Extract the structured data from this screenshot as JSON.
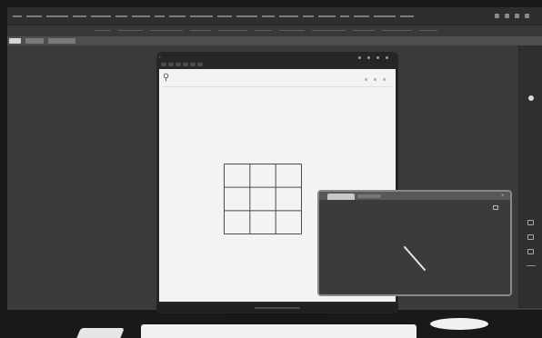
{
  "menubar": {
    "menu_items": [
      {
        "label": ""
      },
      {
        "label": ""
      },
      {
        "label": ""
      },
      {
        "label": ""
      },
      {
        "label": ""
      },
      {
        "label": ""
      },
      {
        "label": ""
      },
      {
        "label": ""
      },
      {
        "label": ""
      },
      {
        "label": ""
      },
      {
        "label": ""
      },
      {
        "label": ""
      },
      {
        "label": ""
      },
      {
        "label": ""
      },
      {
        "label": ""
      },
      {
        "label": ""
      },
      {
        "label": ""
      },
      {
        "label": ""
      },
      {
        "label": ""
      },
      {
        "label": ""
      }
    ],
    "status_icons": [
      "wifi-icon",
      "battery-icon",
      "clock-icon",
      "notification-icon"
    ]
  },
  "ribbon": {
    "items": [
      "",
      "",
      "",
      "",
      "",
      "",
      "",
      "",
      "",
      "",
      ""
    ]
  },
  "tabrow": {
    "tabs": [
      {
        "label": "",
        "active": true
      },
      {
        "label": "",
        "active": false
      },
      {
        "label": "",
        "active": false
      }
    ]
  },
  "app_window": {
    "title": "",
    "back_icon": "chevron-left-icon",
    "controls": [
      "share-icon",
      "more-icon",
      "minimize-icon",
      "close-icon"
    ],
    "toolbar_tabs": [
      "",
      "",
      "",
      "",
      "",
      ""
    ],
    "search": {
      "icon": "search-icon",
      "placeholder": ""
    },
    "canvas_controls": [
      "undo-icon",
      "redo-icon",
      "settings-icon"
    ],
    "grid": {
      "rows": 3,
      "cols": 3
    }
  },
  "mini_window": {
    "active_tab": "",
    "inactive_tab": "",
    "close_icon": "close-icon",
    "tool_icon": "chat-icon"
  },
  "right_panel": {
    "tools": [
      "layers-icon",
      "image-icon",
      "text-icon",
      "minus-icon"
    ]
  },
  "colors": {
    "workspace": "#3a3a3a",
    "canvas": "#f3f3f3",
    "window_frame": "#262626",
    "mini_window_border": "#898989",
    "grid_stroke": "#4a4a4a"
  }
}
